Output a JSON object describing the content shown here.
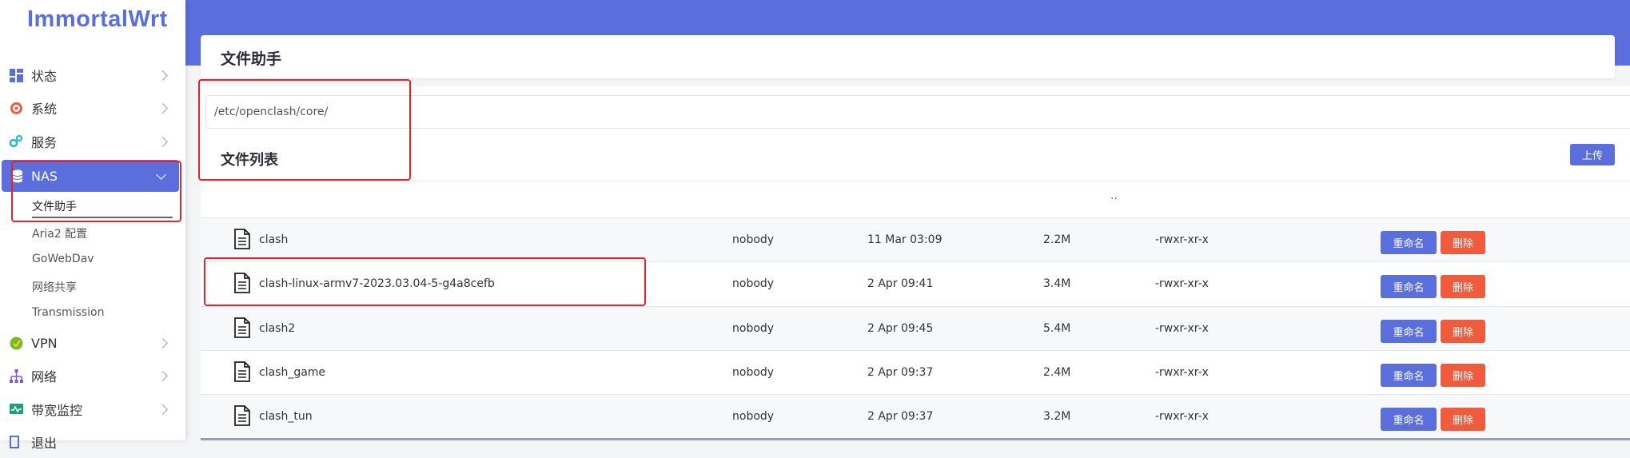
{
  "brand": {
    "name": "ImmortalWrt",
    "accent": "#5a6fdb",
    "danger": "#ef5b3c",
    "highlight": "#e6232a"
  },
  "sidebar": {
    "items": [
      {
        "label": "状态",
        "icon": "dashboard-icon"
      },
      {
        "label": "系统",
        "icon": "gear-icon"
      },
      {
        "label": "服务",
        "icon": "services-icon"
      },
      {
        "label": "NAS",
        "icon": "database-icon"
      },
      {
        "label": "VPN",
        "icon": "vpn-icon"
      },
      {
        "label": "网络",
        "icon": "network-icon"
      },
      {
        "label": "带宽监控",
        "icon": "bandwidth-icon"
      },
      {
        "label": "退出",
        "icon": "logout-icon"
      }
    ],
    "nas_sub": [
      "文件助手",
      "Aria2 配置",
      "GoWebDav",
      "网络共享",
      "Transmission"
    ]
  },
  "page": {
    "title": "文件助手",
    "path": "/etc/openclash/core/",
    "list_title": "文件列表",
    "upload": "上传",
    "updir": ".."
  },
  "actions": {
    "rename": "重命名",
    "delete": "删除"
  },
  "files": [
    {
      "name": "clash",
      "owner": "nobody",
      "date": "11 Mar 03:09",
      "size": "2.2M",
      "perm": "-rwxr-xr-x"
    },
    {
      "name": "clash-linux-armv7-2023.03.04-5-g4a8cefb",
      "owner": "nobody",
      "date": "2 Apr 09:41",
      "size": "3.4M",
      "perm": "-rwxr-xr-x"
    },
    {
      "name": "clash2",
      "owner": "nobody",
      "date": "2 Apr 09:45",
      "size": "5.4M",
      "perm": "-rwxr-xr-x"
    },
    {
      "name": "clash_game",
      "owner": "nobody",
      "date": "2 Apr 09:37",
      "size": "2.4M",
      "perm": "-rwxr-xr-x"
    },
    {
      "name": "clash_tun",
      "owner": "nobody",
      "date": "2 Apr 09:37",
      "size": "3.2M",
      "perm": "-rwxr-xr-x"
    }
  ]
}
